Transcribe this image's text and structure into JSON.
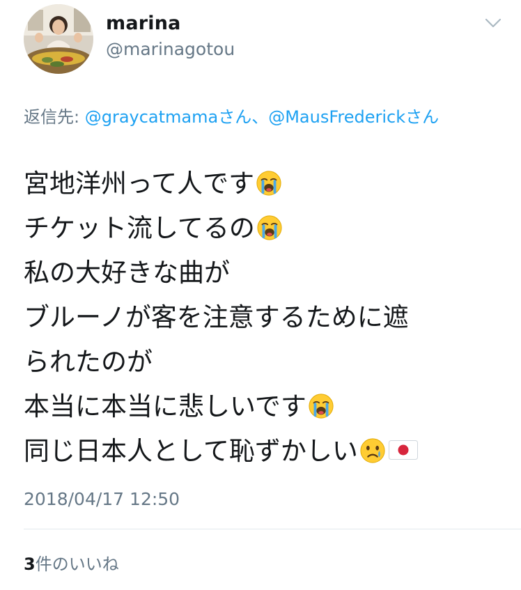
{
  "author": {
    "display_name": "marina",
    "handle": "@marinagotou",
    "avatar_icon": "avatar-photo"
  },
  "header": {
    "caret_icon": "chevron-down-icon"
  },
  "reply": {
    "prefix": "返信先: ",
    "mention1": "@graycatmama",
    "suffix1": "さん、",
    "mention2": "@MausFrederick",
    "suffix2": "さん"
  },
  "tweet": {
    "lines": [
      "宮地洋州って人です",
      "チケット流してるの",
      "私の大好きな曲が",
      "ブルーノが客を注意するために遮",
      "られたのが",
      "本当に本当に悲しいです",
      "同じ日本人として恥ずかしい"
    ],
    "emojis": [
      "loudly-crying-face-icon",
      "crying-face-icon",
      "japan-flag-icon"
    ]
  },
  "timestamp": "2018/04/17 12:50",
  "likes": {
    "count": "3",
    "label": "件のいいね"
  },
  "colors": {
    "link": "#1da1f2",
    "muted": "#657786",
    "text": "#14171a",
    "divider": "#e1e8ed"
  }
}
